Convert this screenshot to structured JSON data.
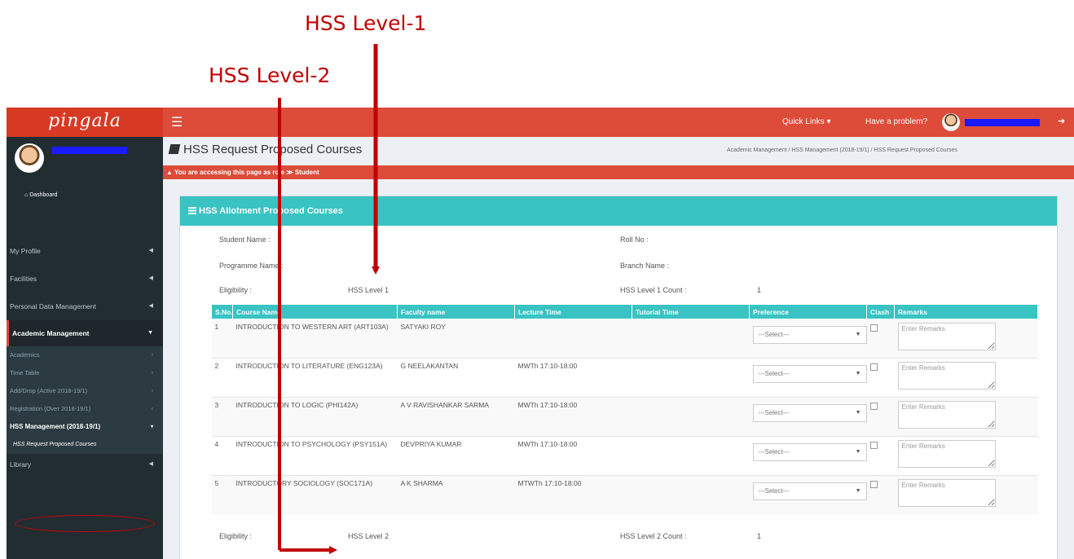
{
  "annotations": {
    "level1": "HSS Level-1",
    "level2": "HSS Level-2"
  },
  "colors": {
    "topbar": "#dd4b39",
    "sidebar": "#222d32",
    "box_header": "#39c3c3",
    "annotation": "#c00000"
  },
  "header": {
    "logo": "pingala",
    "menu_icon": "hamburger-icon",
    "quick_links": "Quick Links ▾",
    "problem": "Have a problem?"
  },
  "sidebar": {
    "dashboard": "Dashboard",
    "items": [
      {
        "label": "My Profile"
      },
      {
        "label": "Facilities"
      },
      {
        "label": "Personal Data Management"
      },
      {
        "label": "Academic Management"
      }
    ],
    "sub_items": [
      {
        "label": "Academics"
      },
      {
        "label": "Time Table"
      },
      {
        "label": "Add/Drop (Active 2018-19/1)"
      },
      {
        "label": "Registration (Over 2018-19/1)"
      },
      {
        "label": "HSS Management (2018-19/1)"
      },
      {
        "label": "HSS Request Proposed Courses"
      }
    ],
    "library": "Library"
  },
  "page": {
    "title": "HSS Request Proposed Courses",
    "breadcrumb": "Academic Management  /  HSS Management (2018-19/1)  /  HSS Request Proposed Courses",
    "role_notice": "You are accessing this page as role ≫ Student",
    "box_title": "HSS Allotment Proposed Courses"
  },
  "student": {
    "name_label": "Student Name :",
    "roll_label": "Roll No :",
    "programme_label": "Programme Name :",
    "branch_label": "Branch Name :"
  },
  "level1": {
    "eligibility_label": "Eligibility :",
    "eligibility_value": "HSS Level 1",
    "count_label": "HSS Level 1 Count :",
    "count_value": "1"
  },
  "level2": {
    "eligibility_label": "Eligibility :",
    "eligibility_value": "HSS Level 2",
    "count_label": "HSS Level 2 Count :",
    "count_value": "1"
  },
  "table": {
    "headers": [
      "S.No.",
      "Course Name",
      "Faculty name",
      "Lecture Time",
      "Tutorial Time",
      "Preference",
      "Clash",
      "Remarks"
    ],
    "select_placeholder": "---Select---",
    "remarks_placeholder": "Enter Remarks",
    "rows": [
      {
        "sno": "1",
        "course": "INTRODUCTION TO WESTERN ART (ART103A)",
        "faculty": "SATYAKI ROY",
        "lecture": "",
        "tutorial": ""
      },
      {
        "sno": "2",
        "course": "INTRODUCTION TO LITERATURE (ENG123A)",
        "faculty": "G NEELAKANTAN",
        "lecture": "MWTh 17:10-18:00",
        "tutorial": ""
      },
      {
        "sno": "3",
        "course": "INTRODUCTION TO LOGIC (PHI142A)",
        "faculty": "A V RAVISHANKAR SARMA",
        "lecture": "MWTh 17:10-18:00",
        "tutorial": ""
      },
      {
        "sno": "4",
        "course": "INTRODUCTION TO PSYCHOLOGY (PSY151A)",
        "faculty": "DEVPRIYA KUMAR",
        "lecture": "MWTh 17:10-18:00",
        "tutorial": ""
      },
      {
        "sno": "5",
        "course": "INTRODUCTORY SOCIOLOGY (SOC171A)",
        "faculty": "A K SHARMA",
        "lecture": "MTWTh 17:10-18:00",
        "tutorial": ""
      }
    ]
  }
}
